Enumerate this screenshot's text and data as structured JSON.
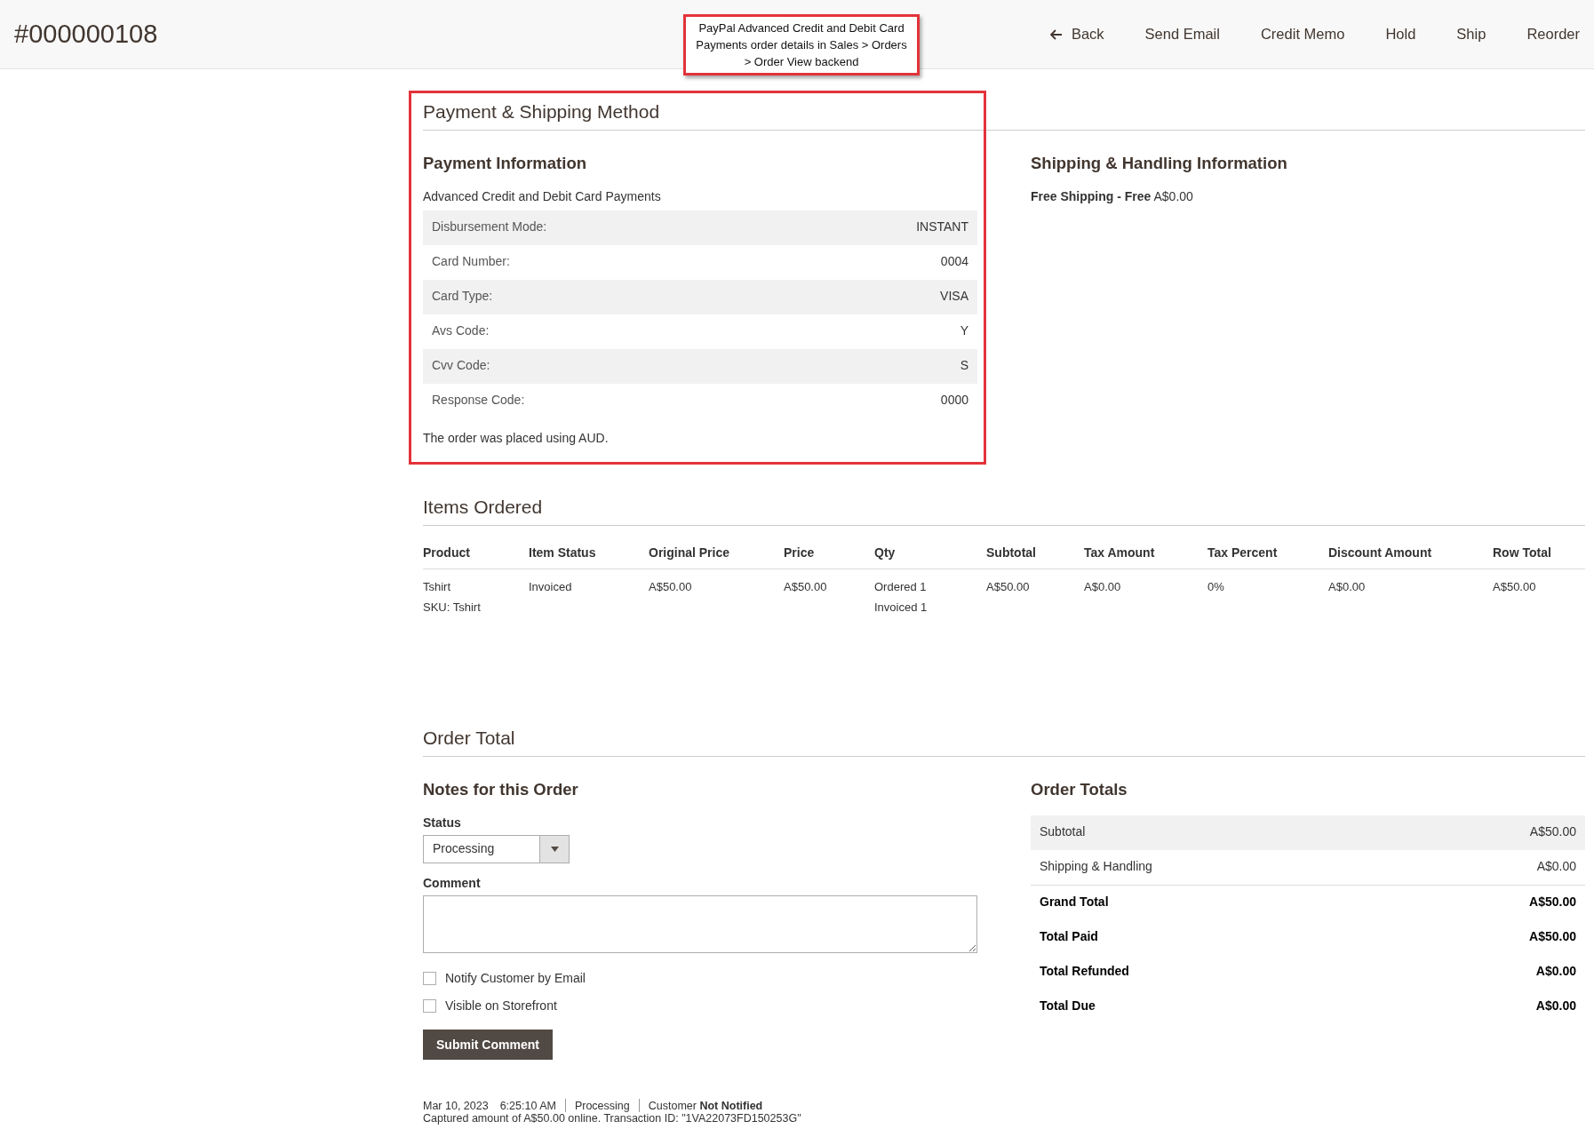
{
  "header": {
    "title": "#000000108",
    "actions": [
      {
        "label": "Back",
        "kind": "back"
      },
      {
        "label": "Send Email",
        "kind": "plain"
      },
      {
        "label": "Credit Memo",
        "kind": "plain"
      },
      {
        "label": "Hold",
        "kind": "plain"
      },
      {
        "label": "Ship",
        "kind": "plain"
      },
      {
        "label": "Reorder",
        "kind": "plain"
      }
    ]
  },
  "annotation": {
    "callout": "PayPal Advanced Credit and Debit Card Payments order details in Sales > Orders > Order View backend"
  },
  "payment_shipping": {
    "title": "Payment & Shipping Method",
    "payment": {
      "heading": "Payment Information",
      "method": "Advanced Credit and Debit Card Payments",
      "rows": [
        {
          "label": "Disbursement Mode:",
          "value": "INSTANT"
        },
        {
          "label": "Card Number:",
          "value": "0004"
        },
        {
          "label": "Card Type:",
          "value": "VISA"
        },
        {
          "label": "Avs Code:",
          "value": "Y"
        },
        {
          "label": "Cvv Code:",
          "value": "S"
        },
        {
          "label": "Response Code:",
          "value": "0000"
        }
      ],
      "note": "The order was placed using AUD."
    },
    "shipping": {
      "heading": "Shipping & Handling Information",
      "method": "**Free Shipping - Free** A$0.00"
    }
  },
  "items_ordered": {
    "title": "Items Ordered",
    "columns": [
      "Product",
      "Item Status",
      "Original Price",
      "Price",
      "Qty",
      "Subtotal",
      "Tax Amount",
      "Tax Percent",
      "Discount Amount",
      "Row Total"
    ],
    "rows": [
      {
        "cells": [
          [
            "Tshirt",
            "SKU: Tshirt"
          ],
          [
            "Invoiced"
          ],
          [
            "A$50.00"
          ],
          [
            "A$50.00"
          ],
          [
            "Ordered 1",
            "Invoiced 1"
          ],
          [
            "A$50.00"
          ],
          [
            "A$0.00"
          ],
          [
            "0%"
          ],
          [
            "A$0.00"
          ],
          [
            "A$50.00"
          ]
        ]
      }
    ]
  },
  "order_total": {
    "title": "Order Total",
    "notes": {
      "heading": "Notes for this Order",
      "status_label": "Status",
      "status_value": "Processing",
      "comment_label": "Comment",
      "checkboxes": [
        {
          "label": "Notify Customer by Email",
          "checked": false
        },
        {
          "label": "Visible on Storefront",
          "checked": false
        }
      ],
      "submit": "Submit Comment",
      "history": [
        {
          "parts": [
            "Mar 10, 2023",
            "6:25:10 AM"
          ],
          "status": "Processing",
          "customer": "Customer **Not Notified**",
          "message": "Captured amount of A$50.00 online. Transaction ID: \"1VA22073FD150253G\""
        }
      ]
    },
    "totals": {
      "heading": "Order Totals",
      "rows": [
        {
          "label": "Subtotal",
          "value": "A$50.00",
          "kind": "shaded"
        },
        {
          "label": "Shipping & Handling",
          "value": "A$0.00",
          "kind": "plain"
        },
        {
          "label": "Grand Total",
          "value": "A$50.00",
          "kind": "strong"
        },
        {
          "label": "Total Paid",
          "value": "A$50.00",
          "kind": "strong"
        },
        {
          "label": "Total Refunded",
          "value": "A$0.00",
          "kind": "strong"
        },
        {
          "label": "Total Due",
          "value": "A$0.00",
          "kind": "strong"
        }
      ]
    }
  }
}
